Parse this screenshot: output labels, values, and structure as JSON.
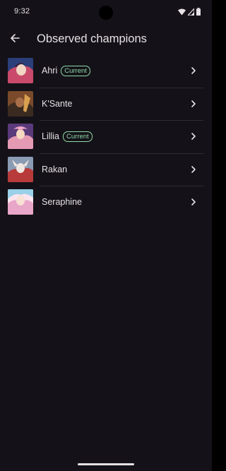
{
  "status_bar": {
    "time": "9:32",
    "icons": [
      "wifi-icon",
      "signal-icon",
      "battery-icon"
    ]
  },
  "app_bar": {
    "back_icon": "arrow-left-icon",
    "title": "Observed champions"
  },
  "champions": [
    {
      "name": "Ahri",
      "current": true,
      "badge": "Current",
      "avatar_colors": [
        "#2b3f7a",
        "#c94a6a",
        "#f1d6c4"
      ]
    },
    {
      "name": "K'Sante",
      "current": false,
      "badge": "",
      "avatar_colors": [
        "#7a4a2a",
        "#d9a050",
        "#3a2a20"
      ]
    },
    {
      "name": "Lillia",
      "current": true,
      "badge": "Current",
      "avatar_colors": [
        "#5a3a7a",
        "#e59ab4",
        "#f5d8c0"
      ]
    },
    {
      "name": "Rakan",
      "current": false,
      "badge": "",
      "avatar_colors": [
        "#8a9bb4",
        "#b83a3a",
        "#f0e6e0"
      ]
    },
    {
      "name": "Seraphine",
      "current": false,
      "badge": "",
      "avatar_colors": [
        "#e8a6c8",
        "#9ad0e8",
        "#fbe4ee"
      ]
    }
  ],
  "row_chevron_icon": "chevron-right-icon",
  "colors": {
    "background": "#141218",
    "text": "#e6e1e5",
    "badge": "#8fd9a8",
    "divider": "#2e2b33"
  }
}
